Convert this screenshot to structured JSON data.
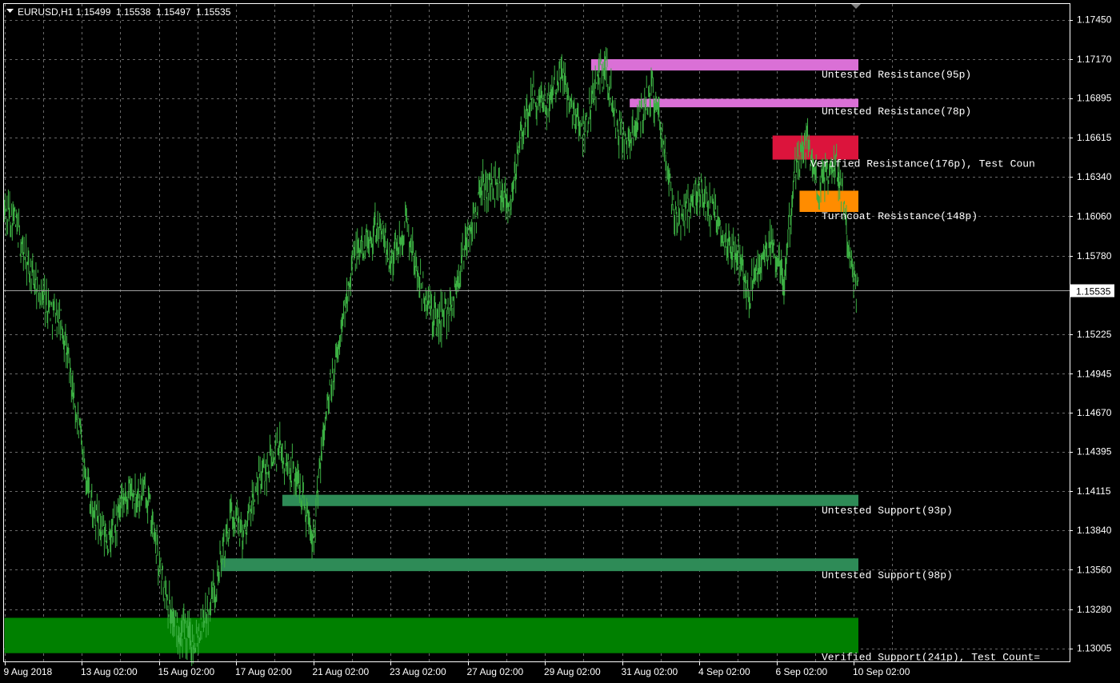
{
  "header": {
    "symbol": "EURUSD,H1",
    "open": "1.15499",
    "high": "1.15538",
    "low": "1.15497",
    "close": "1.15535"
  },
  "price_axis": {
    "labels": [
      "1.17450",
      "1.17170",
      "1.16895",
      "1.16615",
      "1.16340",
      "1.16060",
      "1.15780",
      "1.15225",
      "1.14945",
      "1.14670",
      "1.14395",
      "1.14115",
      "1.13840",
      "1.13560",
      "1.13280",
      "1.13005"
    ],
    "current_price": "1.15535"
  },
  "time_axis": {
    "labels": [
      "9 Aug 2018",
      "13 Aug 02:00",
      "15 Aug 02:00",
      "17 Aug 02:00",
      "21 Aug 02:00",
      "23 Aug 02:00",
      "27 Aug 02:00",
      "29 Aug 02:00",
      "31 Aug 02:00",
      "4 Sep 02:00",
      "6 Sep 02:00",
      "10 Sep 02:00"
    ]
  },
  "colors": {
    "background": "#000000",
    "grid": "#c0c0c0",
    "frame": "#ffffff",
    "candle": "#3cb043",
    "current_price_line": "#a0a0a0",
    "untested_resistance": "#da70d6",
    "verified_resistance": "#dc143c",
    "turncoat_resistance": "#ff8c00",
    "untested_support": "#2e8b57",
    "verified_support": "#008000"
  },
  "zones": [
    {
      "label": "Untested Resistance(95p)",
      "type": "untested_resistance",
      "start_date": "29 Aug",
      "price_low": 1.1709,
      "price_high": 1.1717
    },
    {
      "label": "Untested Resistance(78p)",
      "type": "untested_resistance",
      "start_date": "30 Aug",
      "price_low": 1.1683,
      "price_high": 1.1689
    },
    {
      "label": "Verified Resistance(176p), Test Coun",
      "type": "verified_resistance",
      "start_date": "5 Sep",
      "price_low": 1.1646,
      "price_high": 1.1663
    },
    {
      "label": "Turncoat Resistance(148p)",
      "type": "turncoat_resistance",
      "start_date": "6 Sep",
      "price_low": 1.1609,
      "price_high": 1.1624
    },
    {
      "label": "Untested Support(93p)",
      "type": "untested_support",
      "start_date": "17 Aug",
      "price_low": 1.1401,
      "price_high": 1.1409
    },
    {
      "label": "Untested Support(98p)",
      "type": "untested_support",
      "start_date": "16 Aug",
      "price_low": 1.1355,
      "price_high": 1.1364
    },
    {
      "label": "Verified Support(241p), Test Count=",
      "type": "verified_support",
      "start_date": "9 Aug",
      "price_low": 1.1297,
      "price_high": 1.1322
    }
  ],
  "chart_data": {
    "type": "line",
    "title": "EURUSD,H1",
    "xlabel": "",
    "ylabel": "",
    "ylim": [
      1.1296,
      1.1758
    ],
    "x_dates": [
      "9 Aug 2018",
      "13 Aug 02:00",
      "15 Aug 02:00",
      "17 Aug 02:00",
      "21 Aug 02:00",
      "23 Aug 02:00",
      "27 Aug 02:00",
      "29 Aug 02:00",
      "31 Aug 02:00",
      "4 Sep 02:00",
      "6 Sep 02:00",
      "10 Sep 02:00"
    ],
    "grid": true,
    "series": [
      {
        "x": [
          0,
          0.12,
          0.3,
          0.55,
          0.75,
          0.95,
          1.15,
          1.35,
          1.6,
          1.85,
          2.0,
          2.2,
          2.45,
          2.7,
          2.95,
          3.1,
          3.3,
          3.55,
          3.8,
          4.0,
          4.15,
          4.35,
          4.5,
          4.7,
          4.85,
          5.0,
          5.2,
          5.4,
          5.6,
          5.8,
          6.0,
          6.2,
          6.4,
          6.55,
          6.7,
          6.85,
          7.0,
          7.2,
          7.35,
          7.5,
          7.65,
          7.8,
          7.9,
          8.05,
          8.25,
          8.4,
          8.55,
          8.7,
          8.85,
          9.0,
          9.15,
          9.3,
          9.5,
          9.65,
          9.8,
          9.95,
          10.1,
          10.25,
          10.4,
          10.55,
          10.65,
          10.78,
          10.9,
          11.0,
          11.06
        ],
        "y": [
          1.161,
          1.1605,
          1.157,
          1.1545,
          1.1528,
          1.146,
          1.1395,
          1.1375,
          1.141,
          1.141,
          1.136,
          1.1318,
          1.1305,
          1.1338,
          1.1395,
          1.1382,
          1.1418,
          1.1442,
          1.142,
          1.138,
          1.146,
          1.152,
          1.1575,
          1.159,
          1.16,
          1.1575,
          1.16,
          1.1555,
          1.153,
          1.1545,
          1.159,
          1.1625,
          1.163,
          1.1615,
          1.1665,
          1.169,
          1.168,
          1.1712,
          1.1685,
          1.1665,
          1.1698,
          1.1712,
          1.1675,
          1.1655,
          1.168,
          1.1695,
          1.165,
          1.1605,
          1.1612,
          1.1625,
          1.161,
          1.1595,
          1.158,
          1.155,
          1.1575,
          1.1585,
          1.156,
          1.1642,
          1.166,
          1.1622,
          1.1635,
          1.1645,
          1.16,
          1.156,
          1.1553
        ]
      }
    ]
  }
}
